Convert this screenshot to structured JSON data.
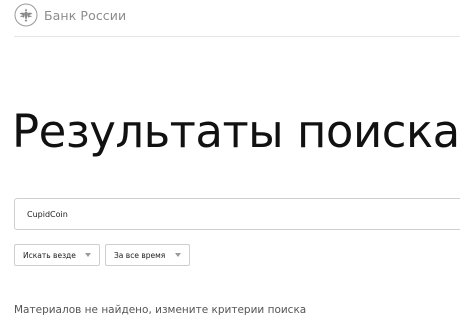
{
  "header": {
    "logo_icon": "bank-of-russia-eagle-icon",
    "brand_name": "Банк России"
  },
  "main": {
    "title": "Результаты поиска",
    "search": {
      "value": "CupidCoin"
    },
    "filters": {
      "scope": "Искать везде",
      "time": "За все время"
    },
    "empty_message": "Материалов не найдено, измените критерии поиска"
  },
  "colors": {
    "title_text": "#111111",
    "muted_text": "#8c8c8c",
    "border": "#cfcfcf"
  }
}
